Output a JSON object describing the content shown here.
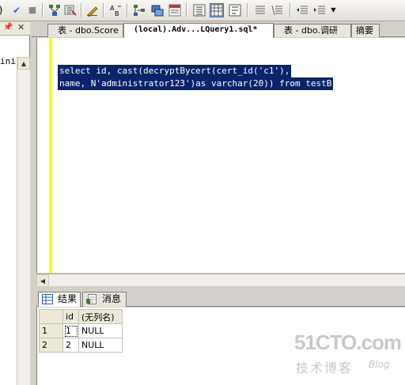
{
  "toolbar": {
    "colors": {
      "check": "#2c6fd1",
      "pressed": "#c1d2ee"
    },
    "icons": [
      "parse-icon",
      "cancel-query-icon",
      "display-estimated-plan-icon",
      "query-options-icon",
      "intellisense-icon",
      "specify-template-values-icon",
      "include-actual-plan-icon",
      "include-client-statistics-icon",
      "results-to-text-icon",
      "results-to-grid-icon",
      "results-to-file-icon",
      "comment-icon",
      "uncomment-icon",
      "decrease-indent-icon",
      "increase-indent-icon",
      "toolbar-options-icon"
    ]
  },
  "left_panel": {
    "fragment_text": "ini"
  },
  "tabs": [
    {
      "label": "表 - dbo.Score"
    },
    {
      "label": "(local).Adv...LQuery1.sql*"
    },
    {
      "label": "表 - dbo.调研"
    },
    {
      "label": "摘要"
    }
  ],
  "editor": {
    "lines": [
      "select id, cast(decryptBycert(cert_id('c1'),",
      "name, N'administrator123')as varchar(20)) from testB"
    ]
  },
  "results_tabs": [
    {
      "label": "结果"
    },
    {
      "label": "消息"
    }
  ],
  "results": {
    "columns": [
      "id",
      "(无列名)"
    ],
    "rows": [
      {
        "rownum": "1",
        "id": "1",
        "value": "NULL"
      },
      {
        "rownum": "2",
        "id": "2",
        "value": "NULL"
      }
    ]
  },
  "watermark": {
    "site": "51CTO.com",
    "subtitle": "技术博客",
    "blog": "Blog"
  }
}
